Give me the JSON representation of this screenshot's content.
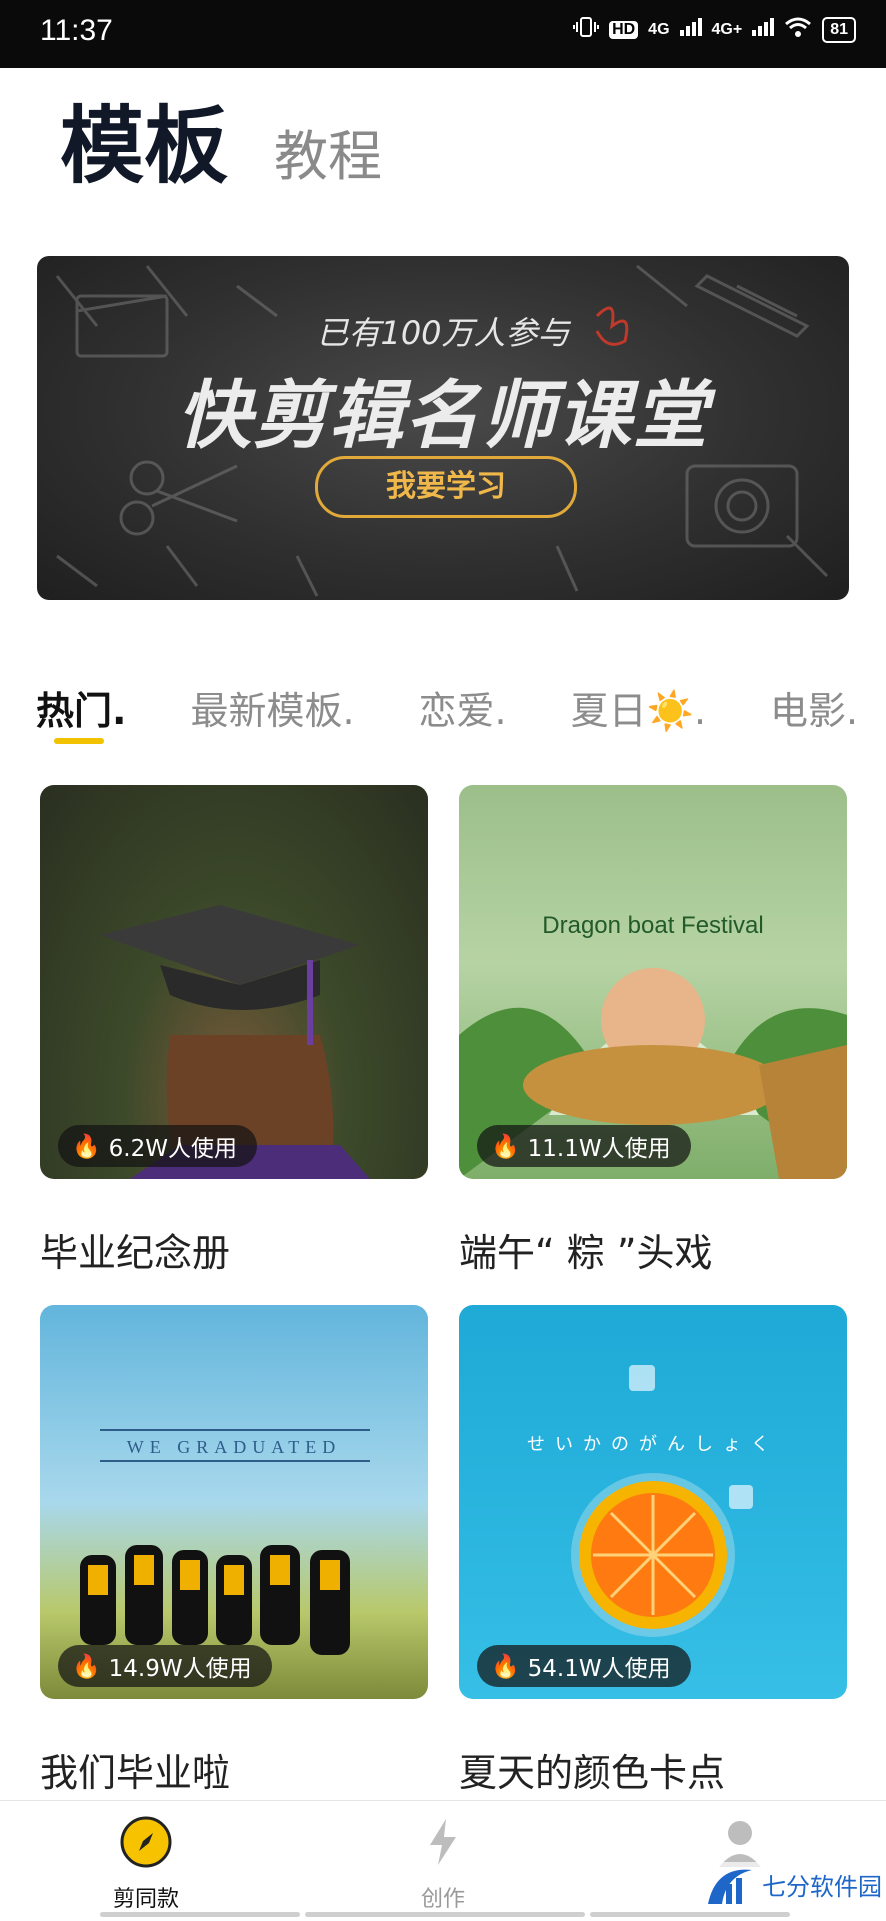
{
  "status": {
    "time": "11:37",
    "hd": "HD",
    "net1": "4G",
    "net2": "4G+",
    "battery": "81"
  },
  "header": {
    "tab_active": "模板",
    "tab_inactive": "教程"
  },
  "banner": {
    "subtitle": "已有100万人参与",
    "title": "快剪辑名师课堂",
    "button": "我要学习"
  },
  "categories": [
    "热门.",
    "最新模板.",
    "恋爱.",
    "夏日☀️.",
    "电影."
  ],
  "cards": [
    {
      "title": "毕业纪念册",
      "usage": "6.2W人使用"
    },
    {
      "title": "端午“ 粽 ”头戏",
      "usage": "11.1W人使用",
      "overlay": "Dragon boat Festival"
    },
    {
      "title": "我们毕业啦",
      "usage": "14.9W人使用",
      "overlay": "WE GRADUATED"
    },
    {
      "title": "夏天的颜色卡点",
      "usage": "54.1W人使用",
      "overlay": "せいかのがんしょく"
    }
  ],
  "nav": {
    "items": [
      "剪同款",
      "创作",
      ""
    ]
  },
  "watermark": "七分软件园",
  "colors": {
    "accent": "#f2c100",
    "banner_button": "#e0a93a",
    "dark": "#111827"
  }
}
